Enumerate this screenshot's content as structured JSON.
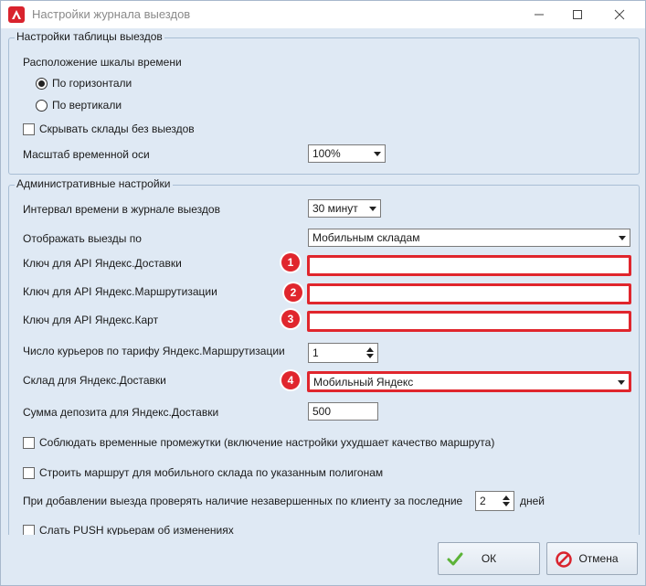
{
  "window": {
    "title": "Настройки журнала выездов"
  },
  "table_settings": {
    "title": "Настройки таблицы выездов",
    "timeline_label": "Расположение шкалы времени",
    "radio_horizontal": "По горизонтали",
    "radio_vertical": "По вертикали",
    "selected_orientation": "horizontal",
    "hide_empty_label": "Скрывать склады без выездов",
    "hide_empty_checked": false,
    "scale_label": "Масштаб временной оси",
    "scale_value": "100%"
  },
  "admin_settings": {
    "title": "Административные настройки",
    "interval_label": "Интервал времени в журнале выездов",
    "interval_value": "30 минут",
    "display_by_label": "Отображать выезды по",
    "display_by_value": "Мобильным складам",
    "api_delivery_label": "Ключ для API Яндекс.Доставки",
    "api_delivery_value": "",
    "api_routing_label": "Ключ для API Яндекс.Маршрутизации",
    "api_routing_value": "",
    "api_maps_label": "Ключ для API Яндекс.Карт",
    "api_maps_value": "",
    "couriers_label": "Число курьеров по тарифу Яндекс.Маршрутизации",
    "couriers_value": "1",
    "warehouse_label": "Склад для Яндекс.Доставки",
    "warehouse_value": "Мобильный Яндекс",
    "deposit_label": "Сумма депозита для Яндекс.Доставки",
    "deposit_value": "500",
    "respect_time_label": "Соблюдать временные промежутки (включение настройки ухудшает качество маршрута)",
    "respect_time_checked": false,
    "build_route_label": "Строить маршрут для мобильного склада по указанным полигонам",
    "build_route_checked": false,
    "check_unfinished_label": "При добавлении выезда проверять наличие незавершенных по клиенту за последние",
    "check_unfinished_value": "2",
    "days_label": "дней",
    "push_label": "Слать PUSH курьерам об изменениях",
    "push_checked": false
  },
  "markers": [
    "1",
    "2",
    "3",
    "4"
  ],
  "footer": {
    "ok_label": "ОК",
    "cancel_label": "Отмена"
  },
  "colors": {
    "highlight": "#e0262d",
    "ok_icon": "#5cb338",
    "cancel_icon": "#d9232d"
  }
}
